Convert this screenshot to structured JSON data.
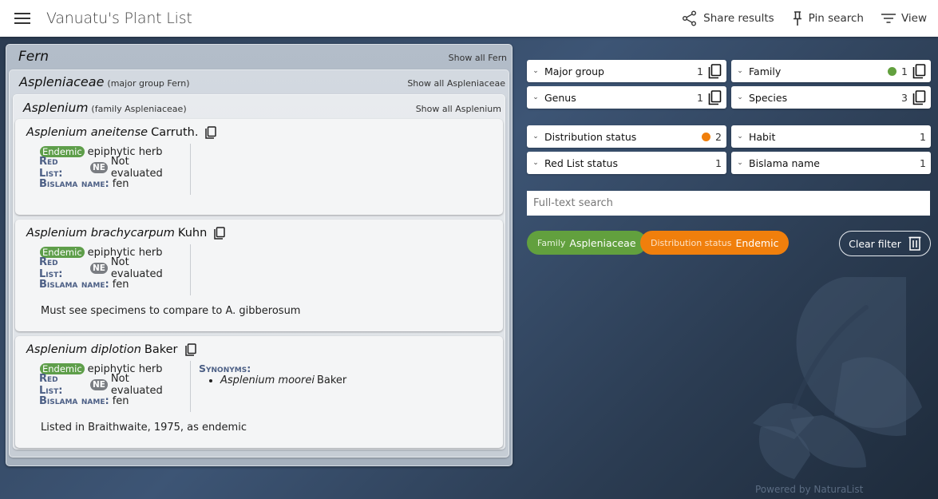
{
  "header": {
    "title": "Vanuatu's Plant List",
    "actions": {
      "share": "Share results",
      "pin": "Pin search",
      "view": "View"
    }
  },
  "results": {
    "major_group": {
      "name": "Fern",
      "show_all": "Show all Fern"
    },
    "family": {
      "name": "Aspleniaceae",
      "context": "(major group Fern)",
      "show_all": "Show all Aspleniaceae"
    },
    "genus": {
      "name": "Asplenium",
      "context": "(family Aspleniaceae)",
      "show_all": "Show all Asplenium"
    },
    "labels": {
      "red_list": "Red List:",
      "bislama": "Bislama name:",
      "synonyms": "Synonyms:"
    },
    "species": [
      {
        "name": "Asplenium aneitense",
        "author": "Carruth.",
        "distribution_badge": "Endemic",
        "habit": "epiphytic herb",
        "red_list_code": "NE",
        "red_list_text": "Not evaluated",
        "bislama_name": "fen"
      },
      {
        "name": "Asplenium brachycarpum",
        "author": "Kuhn",
        "distribution_badge": "Endemic",
        "habit": "epiphytic herb",
        "red_list_code": "NE",
        "red_list_text": "Not evaluated",
        "bislama_name": "fen",
        "note": "Must see specimens to compare to A. gibberosum"
      },
      {
        "name": "Asplenium diplotion",
        "author": "Baker",
        "distribution_badge": "Endemic",
        "habit": "epiphytic herb",
        "red_list_code": "NE",
        "red_list_text": "Not evaluated",
        "bislama_name": "fen",
        "synonyms": [
          {
            "name": "Asplenium moorei",
            "author": "Baker"
          }
        ],
        "note": "Listed in Braithwaite, 1975, as endemic"
      }
    ]
  },
  "filters": {
    "facets": [
      {
        "label": "Major group",
        "count": "1"
      },
      {
        "label": "Family",
        "count": "1",
        "active_color": "#62a03e"
      },
      {
        "label": "Genus",
        "count": "1"
      },
      {
        "label": "Species",
        "count": "3"
      },
      {
        "label": "Distribution status",
        "count": "2",
        "active_color": "#f07f0c"
      },
      {
        "label": "Habit",
        "count": "1"
      },
      {
        "label": "Red List status",
        "count": "1"
      },
      {
        "label": "Bislama name",
        "count": "1"
      }
    ],
    "search_placeholder": "Full-text search",
    "active": [
      {
        "key": "Family",
        "value": "Aspleniaceae",
        "color": "#62a03e"
      },
      {
        "key": "Distribution status",
        "value": "Endemic",
        "color": "#f07f0c"
      }
    ],
    "clear_label": "Clear filter"
  },
  "footer": {
    "powered_by": "Powered by NaturaList"
  }
}
